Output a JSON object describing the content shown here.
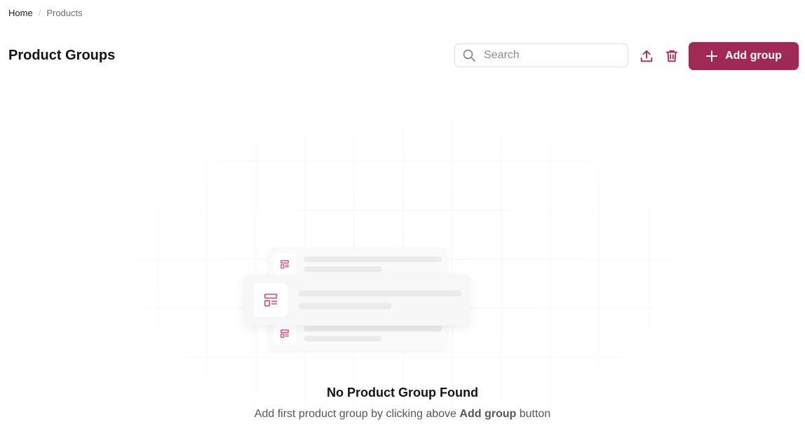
{
  "breadcrumb": {
    "home": "Home",
    "separator": "/",
    "current": "Products"
  },
  "header": {
    "title": "Product Groups",
    "search_placeholder": "Search",
    "search_value": "",
    "add_button_label": "Add group"
  },
  "icons": {
    "search": "search-icon",
    "upload": "upload-icon",
    "delete": "trash-icon",
    "add": "plus-icon",
    "group": "layout-template-icon"
  },
  "empty_state": {
    "title": "No Product Group Found",
    "description_before": "Add first product group by clicking above ",
    "description_emphasis": "Add group",
    "description_after": " button"
  },
  "colors": {
    "accent": "#a02a55",
    "icon_pink": "#d45a87",
    "text_primary": "#141414",
    "text_muted": "#55555c"
  }
}
